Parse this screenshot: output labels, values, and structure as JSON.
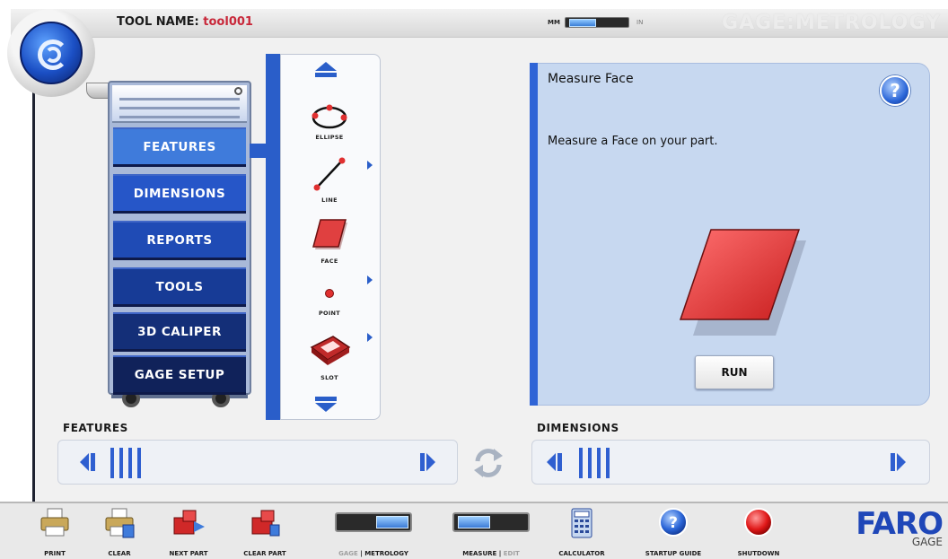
{
  "header": {
    "tool_name_label": "TOOL NAME:",
    "tool_name_value": "tool001",
    "unit_left": "MM",
    "unit_right": "IN",
    "brand_title": "GAGE:METROLOGY"
  },
  "cart": {
    "drawers": [
      {
        "label": "FEATURES",
        "color": "#3f7bdb"
      },
      {
        "label": "DIMENSIONS",
        "color": "#2656c8"
      },
      {
        "label": "REPORTS",
        "color": "#1f4bb5"
      },
      {
        "label": "TOOLS",
        "color": "#173b96"
      },
      {
        "label": "3D CALIPER",
        "color": "#142f78"
      },
      {
        "label": "GAGE SETUP",
        "color": "#10225a"
      }
    ]
  },
  "feature_strip": {
    "items": [
      {
        "label": "ELLIPSE",
        "icon": "ellipse-icon"
      },
      {
        "label": "LINE",
        "icon": "line-icon"
      },
      {
        "label": "FACE",
        "icon": "face-icon"
      },
      {
        "label": "POINT",
        "icon": "point-icon"
      },
      {
        "label": "SLOT",
        "icon": "slot-icon"
      }
    ]
  },
  "detail": {
    "title": "Measure Face",
    "description": "Measure a Face on your part.",
    "run_label": "RUN",
    "help_label": "?"
  },
  "sections": {
    "features_label": "FEATURES",
    "dimensions_label": "DIMENSIONS"
  },
  "toolbar": {
    "print": "PRINT",
    "clear": "CLEAR",
    "next_part": "NEXT PART",
    "clear_part": "CLEAR PART",
    "gage_metrology_off": "GAGE",
    "gage_metrology_sep": " | ",
    "gage_metrology_on": "METROLOGY",
    "measure_edit_on": "MEASURE",
    "measure_edit_sep": " | ",
    "measure_edit_off": "EDIT",
    "calculator": "CALCULATOR",
    "startup_guide": "STARTUP GUIDE",
    "shutdown": "SHUTDOWN"
  },
  "brand": {
    "faro": "FARO",
    "gage": "GAGE",
    "accent": "#1f47b8"
  }
}
